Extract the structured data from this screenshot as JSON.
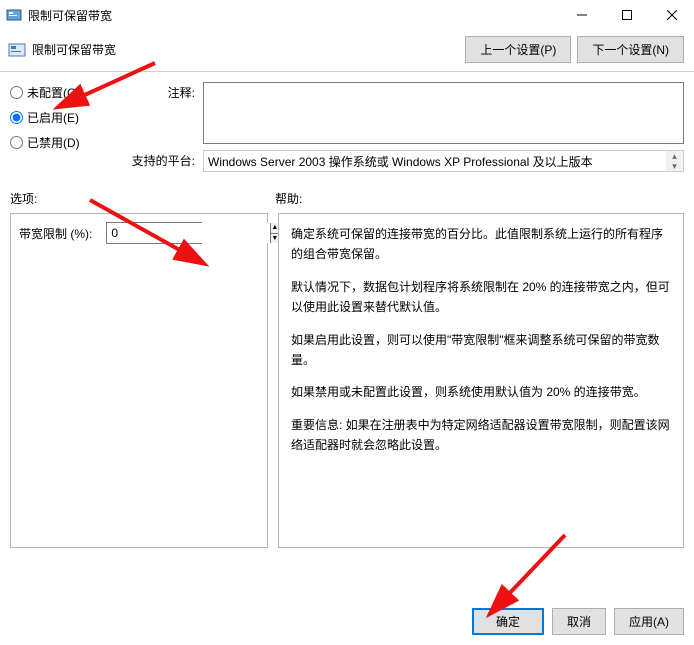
{
  "window": {
    "title": "限制可保留带宽"
  },
  "header": {
    "title": "限制可保留带宽",
    "prev_button": "上一个设置(P)",
    "next_button": "下一个设置(N)"
  },
  "radios": {
    "not_configured": "未配置(C)",
    "enabled": "已启用(E)",
    "disabled": "已禁用(D)",
    "selected": "enabled"
  },
  "fields": {
    "comment_label": "注释:",
    "comment_value": "",
    "platform_label": "支持的平台:",
    "platform_value": "Windows Server 2003 操作系统或 Windows XP Professional 及以上版本"
  },
  "sections": {
    "options_label": "选项:",
    "help_label": "帮助:"
  },
  "options": {
    "bandwidth_label": "带宽限制 (%):",
    "bandwidth_value": "0"
  },
  "help": {
    "p1": "确定系统可保留的连接带宽的百分比。此值限制系统上运行的所有程序的组合带宽保留。",
    "p2": "默认情况下，数据包计划程序将系统限制在 20% 的连接带宽之内，但可以使用此设置来替代默认值。",
    "p3": "如果启用此设置，则可以使用\"带宽限制\"框来调整系统可保留的带宽数量。",
    "p4": "如果禁用或未配置此设置，则系统使用默认值为 20% 的连接带宽。",
    "p5": "重要信息: 如果在注册表中为特定网络适配器设置带宽限制，则配置该网络适配器时就会忽略此设置。"
  },
  "footer": {
    "ok": "确定",
    "cancel": "取消",
    "apply": "应用(A)"
  }
}
